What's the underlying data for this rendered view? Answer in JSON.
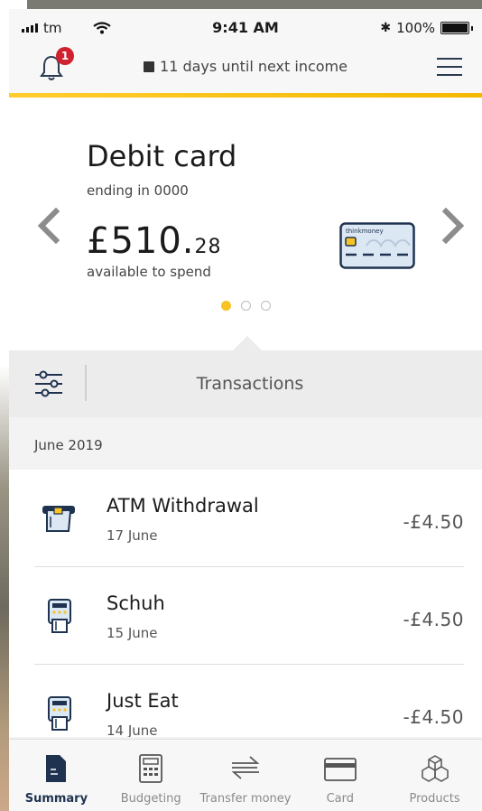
{
  "status_bar": {
    "carrier": "tm",
    "time": "9:41 AM",
    "battery": "100%"
  },
  "header": {
    "notification_count": "1",
    "income_text": "11 days until next income"
  },
  "card": {
    "title": "Debit card",
    "ending": "ending in 0000",
    "balance_main": "£510.",
    "balance_pence": "28",
    "available_label": "available to spend",
    "brand_text": "thinkmoney",
    "carousel_pages": 3,
    "carousel_active": 0
  },
  "transactions_bar": {
    "label": "Transactions"
  },
  "month_header": "June 2019",
  "transactions": [
    {
      "name": "ATM Withdrawal",
      "date": "17 June",
      "amount_main": "-£4.",
      "amount_pence": "50",
      "icon": "atm-icon"
    },
    {
      "name": "Schuh",
      "date": "15 June",
      "amount_main": "-£4.",
      "amount_pence": "50",
      "icon": "card-terminal-icon"
    },
    {
      "name": "Just Eat",
      "date": "14 June",
      "amount_main": "-£4.",
      "amount_pence": "50",
      "icon": "card-terminal-icon"
    }
  ],
  "tabs": [
    {
      "label": "Summary",
      "icon": "document-icon",
      "active": true
    },
    {
      "label": "Budgeting",
      "icon": "calculator-icon",
      "active": false
    },
    {
      "label": "Transfer money",
      "icon": "transfer-arrows-icon",
      "active": false
    },
    {
      "label": "Card",
      "icon": "card-icon",
      "active": false
    },
    {
      "label": "Products",
      "icon": "cubes-icon",
      "active": false
    }
  ],
  "colors": {
    "accent": "#f7c325",
    "navy": "#1f3350",
    "badge": "#d0212f"
  }
}
